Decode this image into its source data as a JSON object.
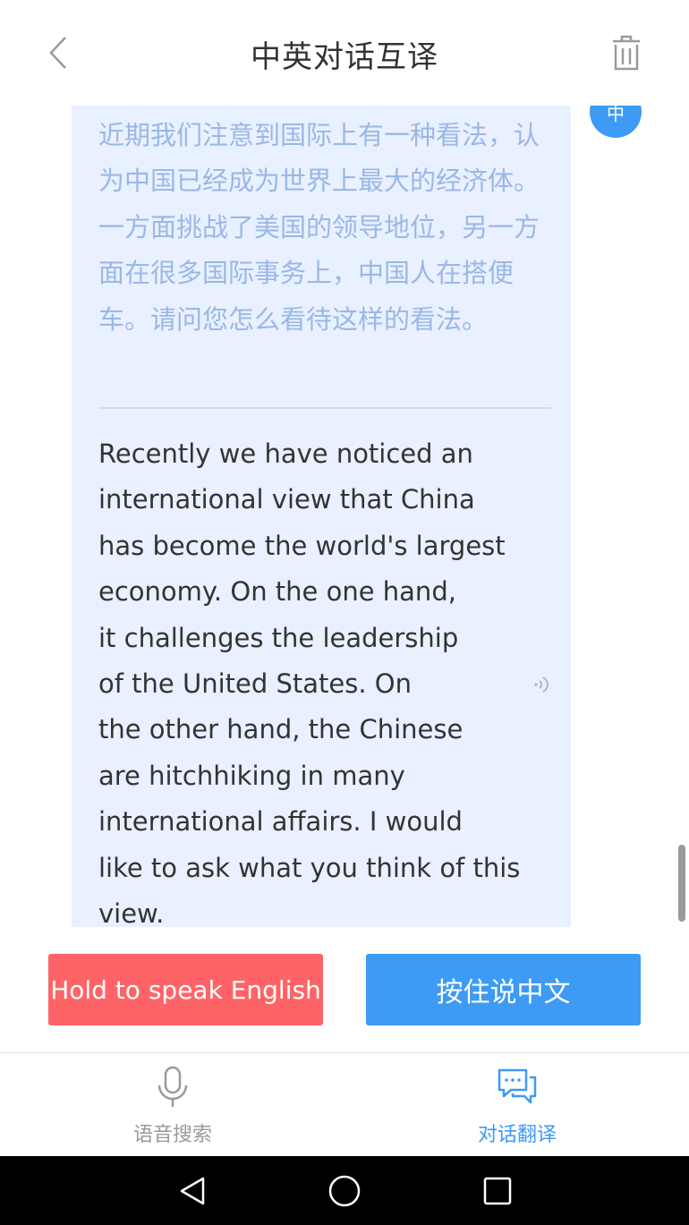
{
  "header": {
    "title": "中英对话互译",
    "back_icon": "chevron-left-icon",
    "delete_icon": "trash-icon"
  },
  "conversation": {
    "language_badge": "中",
    "source_text": "近期我们注意到国际上有一种看法，认为中国已经成为世界上最大的经济体。一方面挑战了美国的领导地位，另一方面在很多国际事务上，中国人在搭便车。请问您怎么看待这样的看法。",
    "translated_text": "Recently we have noticed an\ninternational view that China\nhas become the world's largest\neconomy. On the one hand,\nit challenges the leadership\nof the United States. On\nthe other hand, the Chinese\nare hitchhiking in many\ninternational affairs. I would\nlike to ask what you think of this\nview.",
    "speaker_icon": "speaker-icon"
  },
  "actions": {
    "english_button": "Hold to speak English",
    "chinese_button": "按住说中文"
  },
  "tabs": [
    {
      "label": "语音搜索",
      "icon": "microphone-icon",
      "active": false
    },
    {
      "label": "对话翻译",
      "icon": "chat-bubbles-icon",
      "active": true
    }
  ],
  "colors": {
    "accent": "#3d9af5",
    "english_button": "#fe6467",
    "bubble_bg": "#e9f0ff",
    "source_text": "#9ab8e6"
  }
}
